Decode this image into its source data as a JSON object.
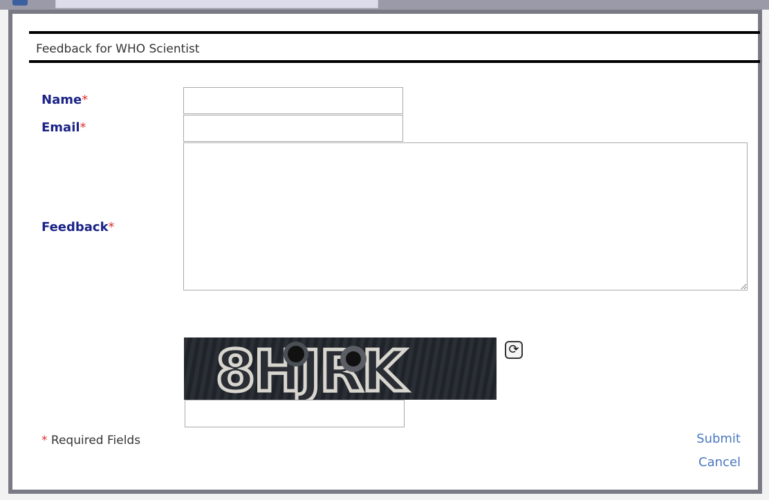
{
  "modal": {
    "title": "Feedback for WHO Scientist"
  },
  "form": {
    "name_label": "Name",
    "email_label": "Email",
    "feedback_label": "Feedback",
    "required_marker": "*",
    "name_value": "",
    "email_value": "",
    "feedback_value": ""
  },
  "captcha": {
    "text": "8HJRK",
    "answer_value": "",
    "refresh_icon": "refresh-icon"
  },
  "footer": {
    "required_marker": "*",
    "required_note": "Required Fields",
    "submit_label": "Submit",
    "cancel_label": "Cancel"
  },
  "colors": {
    "label": "#1a2386",
    "required": "#e03030",
    "link": "#4a78c0"
  }
}
